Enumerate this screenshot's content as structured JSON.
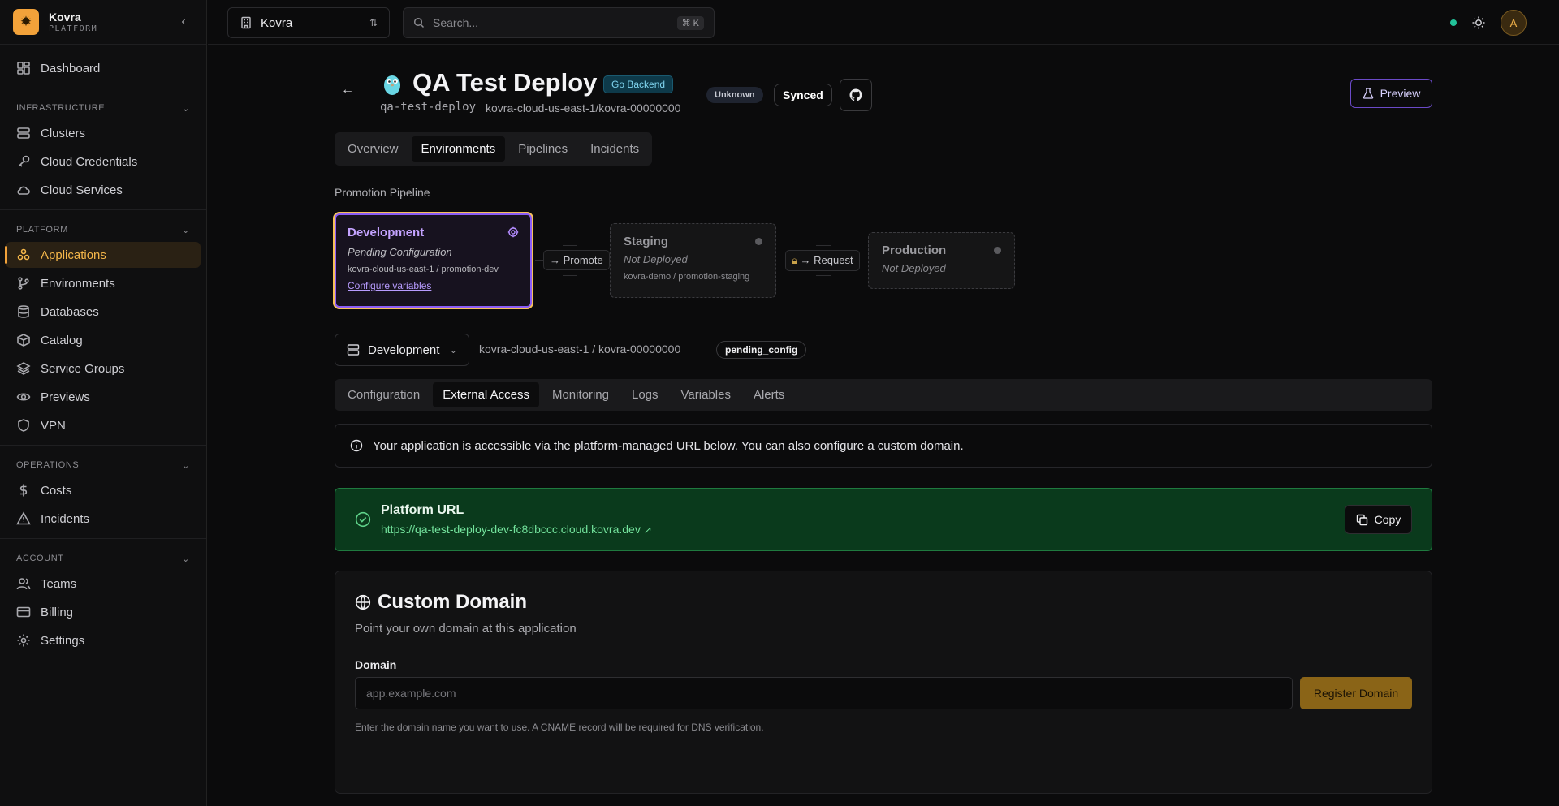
{
  "brand": {
    "name": "Kovra",
    "sub": "PLATFORM"
  },
  "nav": {
    "top": [
      {
        "label": "Dashboard",
        "icon": "dashboard-icon"
      }
    ],
    "sections": [
      {
        "title": "INFRASTRUCTURE",
        "items": [
          {
            "label": "Clusters",
            "icon": "server-icon"
          },
          {
            "label": "Cloud Credentials",
            "icon": "key-icon"
          },
          {
            "label": "Cloud Services",
            "icon": "cloud-icon"
          }
        ]
      },
      {
        "title": "PLATFORM",
        "items": [
          {
            "label": "Applications",
            "icon": "apps-icon",
            "active": true
          },
          {
            "label": "Environments",
            "icon": "branch-icon"
          },
          {
            "label": "Databases",
            "icon": "database-icon"
          },
          {
            "label": "Catalog",
            "icon": "box-icon"
          },
          {
            "label": "Service Groups",
            "icon": "layers-icon"
          },
          {
            "label": "Previews",
            "icon": "eye-icon"
          },
          {
            "label": "VPN",
            "icon": "shield-icon"
          }
        ]
      },
      {
        "title": "OPERATIONS",
        "items": [
          {
            "label": "Costs",
            "icon": "dollar-icon"
          },
          {
            "label": "Incidents",
            "icon": "alert-icon"
          }
        ]
      },
      {
        "title": "ACCOUNT",
        "items": [
          {
            "label": "Teams",
            "icon": "users-icon"
          },
          {
            "label": "Billing",
            "icon": "card-icon"
          },
          {
            "label": "Settings",
            "icon": "gear-icon"
          }
        ]
      }
    ]
  },
  "topbar": {
    "org": "Kovra",
    "search_placeholder": "Search...",
    "search_shortcut": "⌘ K",
    "avatar_initial": "A",
    "status_color": "#22c39a"
  },
  "app": {
    "title": "QA Test Deploy",
    "lang_badge": "Go Backend",
    "slug": "qa-test-deploy",
    "cluster": "kovra-cloud-us-east-1/kovra-00000000",
    "health_badge": "Unknown",
    "sync_badge": "Synced",
    "preview_label": "Preview"
  },
  "main_tabs": [
    {
      "label": "Overview"
    },
    {
      "label": "Environments",
      "active": true
    },
    {
      "label": "Pipelines"
    },
    {
      "label": "Incidents"
    }
  ],
  "pipeline": {
    "label": "Promotion Pipeline",
    "stages": {
      "development": {
        "name": "Development",
        "status": "Pending Configuration",
        "target": "kovra-cloud-us-east-1 / promotion-dev",
        "link": "Configure variables"
      },
      "staging": {
        "name": "Staging",
        "status": "Not Deployed",
        "target": "kovra-demo / promotion-staging"
      },
      "production": {
        "name": "Production",
        "status": "Not Deployed"
      }
    },
    "promote_label": "Promote",
    "request_label": "Request"
  },
  "env": {
    "selected": "Development",
    "path": "kovra-cloud-us-east-1 / kovra-00000000",
    "status_badge": "pending_config"
  },
  "sub_tabs": [
    {
      "label": "Configuration"
    },
    {
      "label": "External Access",
      "active": true
    },
    {
      "label": "Monitoring"
    },
    {
      "label": "Logs"
    },
    {
      "label": "Variables"
    },
    {
      "label": "Alerts"
    }
  ],
  "info_text": "Your application is accessible via the platform-managed URL below. You can also configure a custom domain.",
  "platform_url": {
    "title": "Platform URL",
    "url": "https://qa-test-deploy-dev-fc8dbccc.cloud.kovra.dev",
    "copy_label": "Copy"
  },
  "custom_domain": {
    "title": "Custom Domain",
    "subtitle": "Point your own domain at this application",
    "field_label": "Domain",
    "placeholder": "app.example.com",
    "value": "",
    "button": "Register Domain",
    "help": "Enter the domain name you want to use. A CNAME record will be required for DNS verification."
  }
}
